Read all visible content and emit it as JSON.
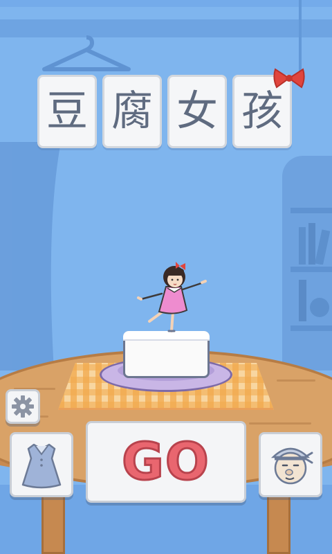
{
  "game": {
    "title_chars": [
      "豆",
      "腐",
      "女",
      "孩"
    ],
    "go_label": "GO"
  },
  "buttons": {
    "settings": {
      "icon": "gear-icon"
    },
    "wardrobe": {
      "icon": "dress-icon"
    },
    "character": {
      "icon": "old-man-face-icon"
    }
  },
  "colors": {
    "background": "#7fb5ee",
    "go_text": "#e9666f",
    "title_text": "#5f6b80",
    "bow": "#e0453d",
    "dress": "#ee8ccf"
  }
}
